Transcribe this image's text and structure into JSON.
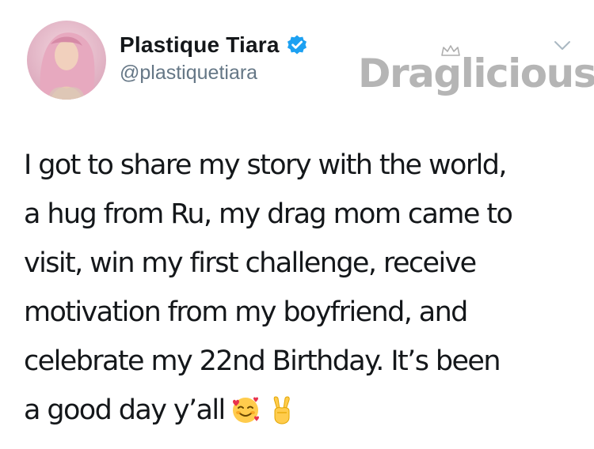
{
  "author": {
    "display_name": "Plastique Tiara",
    "handle": "@plastiquetiara",
    "verified": true
  },
  "watermark": {
    "text": "Draglicious"
  },
  "tweet": {
    "lines": [
      "I got to share my story with the world,",
      "a hug from Ru, my drag mom came to",
      "visit, win my first challenge, receive",
      "motivation from my boyfriend, and",
      "celebrate my 22nd Birthday. It’s been",
      "a good day y’all"
    ],
    "emojis": [
      "smiling-face-with-hearts",
      "victory-hand"
    ]
  },
  "colors": {
    "verified_badge": "#1da1f2",
    "handle": "#657786",
    "text": "#14171a"
  },
  "icons": {
    "menu": "chevron-down-icon",
    "verified": "verified-badge-icon"
  }
}
